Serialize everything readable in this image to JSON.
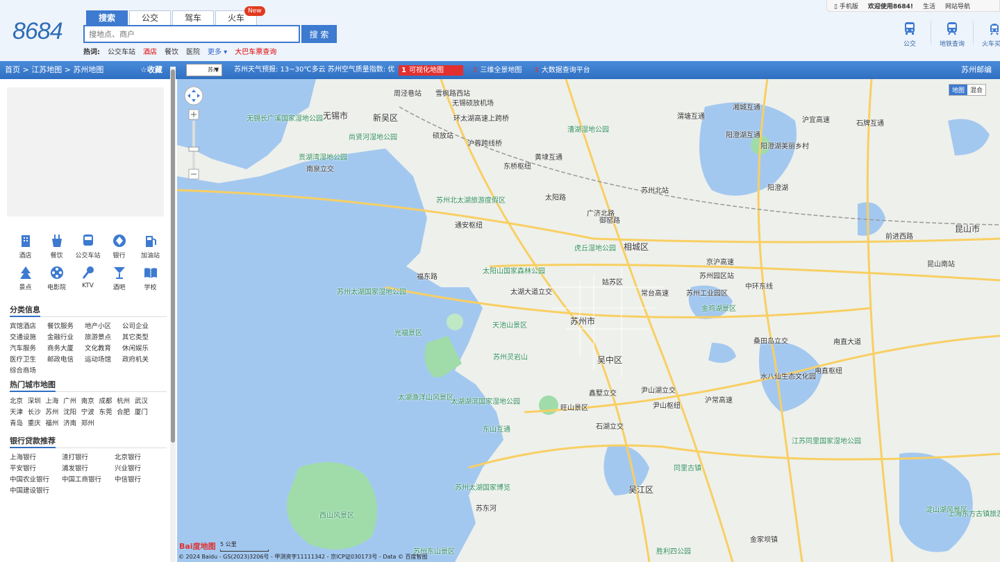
{
  "header": {
    "logo": "8684",
    "tabs": [
      "搜索",
      "公交",
      "驾车",
      "火车"
    ],
    "new_badge": "New",
    "search_placeholder": "搜地点、商户",
    "search_button": "搜 索",
    "hot_label": "热词:",
    "hot_items": [
      "公交车站",
      "酒店",
      "餐饮",
      "医院",
      "更多",
      "大巴车票查询"
    ],
    "top_links": [
      "手机版",
      "欢迎使用8684!",
      "生活",
      "网站导航"
    ],
    "top_icons": [
      "公交",
      "地铁查询",
      "火车买票"
    ]
  },
  "bar": {
    "breadcrumb": "首页 > 江苏地图 > 苏州地图",
    "favorite": "☆收藏",
    "city_select": "苏州",
    "weather": "苏州天气预报: 13~30℃多云    苏州空气质量指数: 优",
    "promo": [
      {
        "num": "1",
        "text": "可视化地图"
      },
      {
        "num": "2",
        "text": "三维全景地图"
      },
      {
        "num": "3",
        "text": "大数据查询平台"
      }
    ],
    "editor": "苏州邮编"
  },
  "sidebar": {
    "categories": [
      {
        "label": "酒店",
        "icon": "hotel-icon"
      },
      {
        "label": "餐饮",
        "icon": "food-icon"
      },
      {
        "label": "公交车站",
        "icon": "bus-icon"
      },
      {
        "label": "银行",
        "icon": "bank-icon"
      },
      {
        "label": "加油站",
        "icon": "gas-icon"
      },
      {
        "label": "景点",
        "icon": "scenic-icon"
      },
      {
        "label": "电影院",
        "icon": "cinema-icon"
      },
      {
        "label": "KTV",
        "icon": "ktv-icon"
      },
      {
        "label": "酒吧",
        "icon": "bar-icon"
      },
      {
        "label": "学校",
        "icon": "school-icon"
      }
    ],
    "classify_title": "分类信息",
    "classify": [
      "宾馆酒店",
      "餐饮服务",
      "地产小区",
      "公司企业",
      "交通设施",
      "金融行业",
      "旅游景点",
      "其它类型",
      "汽车服务",
      "商务大厦",
      "文化教育",
      "休闲娱乐",
      "医疗卫生",
      "邮政电信",
      "运动场馆",
      "政府机关",
      "综合商场"
    ],
    "hotcity_title": "热门城市地图",
    "hotcity": [
      "北京",
      "深圳",
      "上海",
      "广州",
      "南京",
      "成都",
      "杭州",
      "武汉",
      "天津",
      "长沙",
      "苏州",
      "沈阳",
      "宁波",
      "东莞",
      "合肥",
      "厦门",
      "青岛",
      "重庆",
      "福州",
      "济南",
      "郑州"
    ],
    "bank_title": "银行贷款推荐",
    "banks": [
      "上海银行",
      "渣打银行",
      "北京银行",
      "平安银行",
      "浦发银行",
      "兴业银行",
      "中国农业银行",
      "中国工商银行",
      "中信银行",
      "中国建设银行"
    ]
  },
  "map": {
    "type_buttons": [
      "地图",
      "混合"
    ],
    "labels": [
      {
        "t": "周泾巷站"
      },
      {
        "t": "雪枫路西站"
      },
      {
        "t": "无锡市"
      },
      {
        "t": "新吴区"
      },
      {
        "t": "无锡硕放机场"
      },
      {
        "t": "环太湖高速上跨桥"
      },
      {
        "t": "渭塘互通"
      },
      {
        "t": "湘城互通"
      },
      {
        "t": "沪宜高速"
      },
      {
        "t": "石牌互通"
      },
      {
        "t": "漕湖湿地公园"
      },
      {
        "t": "阳澄湖互通"
      },
      {
        "t": "阳澄湖美丽乡村"
      },
      {
        "t": "无锡长广溪国家湿地公园"
      },
      {
        "t": "尚贤河湿地公园"
      },
      {
        "t": "硕放站"
      },
      {
        "t": "沪蓉跨线桥"
      },
      {
        "t": "贡湖湾湿地公园"
      },
      {
        "t": "南泉立交"
      },
      {
        "t": "黄埭互通"
      },
      {
        "t": "东桥枢纽"
      },
      {
        "t": "苏州北站"
      },
      {
        "t": "阳澄湖"
      },
      {
        "t": "太阳路"
      },
      {
        "t": "苏州北太湖旅游度假区"
      },
      {
        "t": "通安枢纽"
      },
      {
        "t": "广济北路"
      },
      {
        "t": "御窑路"
      },
      {
        "t": "相城区"
      },
      {
        "t": "虎丘湿地公园"
      },
      {
        "t": "京沪高速"
      },
      {
        "t": "苏州园区站"
      },
      {
        "t": "昆山市"
      },
      {
        "t": "前进西路"
      },
      {
        "t": "昆山南站"
      },
      {
        "t": "太阳山国家森林公园"
      },
      {
        "t": "福东路"
      },
      {
        "t": "太湖大道立交"
      },
      {
        "t": "姑苏区"
      },
      {
        "t": "常台高速"
      },
      {
        "t": "苏州工业园区"
      },
      {
        "t": "中环东线"
      },
      {
        "t": "金鸡湖景区"
      },
      {
        "t": "苏州太湖国家湿地公园"
      },
      {
        "t": "苏州市"
      },
      {
        "t": "天池山景区"
      },
      {
        "t": "光福景区"
      },
      {
        "t": "苏州灵岩山"
      },
      {
        "t": "吴中区"
      },
      {
        "t": "甪直大道"
      },
      {
        "t": "桑田岛立交"
      },
      {
        "t": "甪直枢纽"
      },
      {
        "t": "水八仙生态文化园"
      },
      {
        "t": "尹山湖立交"
      },
      {
        "t": "鑫墅立交"
      },
      {
        "t": "尹山枢纽"
      },
      {
        "t": "沪常高速"
      },
      {
        "t": "太湖渔洋山风景区"
      },
      {
        "t": "太湖湖滨国家湿地公园"
      },
      {
        "t": "旺山景区"
      },
      {
        "t": "东山互通"
      },
      {
        "t": "石湖立交"
      },
      {
        "t": "同里古镇"
      },
      {
        "t": "江苏同里国家湿地公园"
      },
      {
        "t": "苏州太湖国家博览"
      },
      {
        "t": "吴江区"
      },
      {
        "t": "西山风景区"
      },
      {
        "t": "苏东河"
      },
      {
        "t": "金家坝镇"
      },
      {
        "t": "苏州东山景区"
      },
      {
        "t": "胜利四公园"
      },
      {
        "t": "淀山湖风景区"
      },
      {
        "t": "上海东方古镇旅游"
      }
    ],
    "scale": "5 公里",
    "baidu": "Bai度地图",
    "copyright": "© 2024 Baidu - GS(2023)3206号 - 甲测资字11111342 - 京ICP证030173号 - Data © 百度智图"
  },
  "colors": {
    "accent": "#2f6fc2",
    "water": "#a3c8f0",
    "green": "#9fdcaa",
    "road": "#f8cf62"
  }
}
